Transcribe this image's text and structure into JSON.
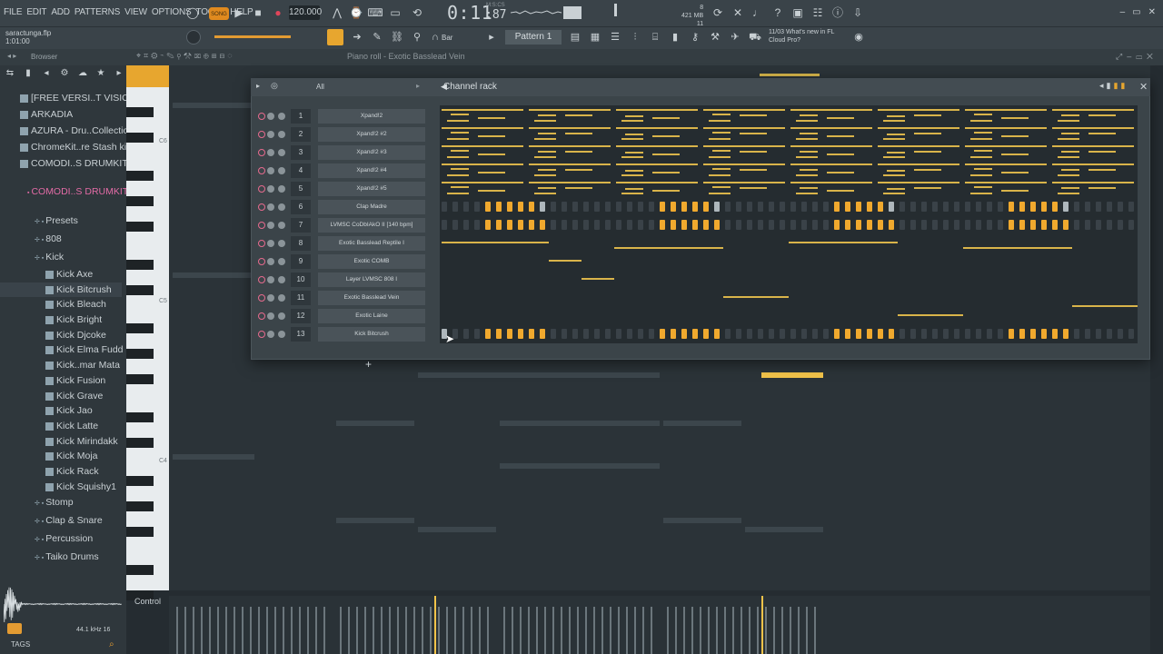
{
  "menu": [
    "FILE",
    "EDIT",
    "ADD",
    "PATTERNS",
    "VIEW",
    "OPTIONS",
    "TOOLS",
    "HELP"
  ],
  "transport": {
    "mode": "SONG",
    "tempo": "120.000",
    "time": "0:11",
    "time_frac": ":87",
    "time_unit": "M:S:CS"
  },
  "system": {
    "memory": "421 MB",
    "cpu": "11",
    "cpu_top": "8"
  },
  "project": {
    "filename": "saractunga.flp",
    "position": "1:01:00"
  },
  "toolbar2": {
    "snap": "Bar",
    "pattern": "Pattern 1"
  },
  "news": {
    "date": "11/03",
    "line1": "What's new in FL",
    "line2": "Cloud Pro?"
  },
  "panel_titles": {
    "browser": "Browser",
    "piano_roll": "Piano roll - Exotic Basslead Vein",
    "channel_rack": "Channel rack",
    "rack_filter": "All",
    "control": "Control"
  },
  "browser": {
    "items": [
      {
        "label": "[FREE VERSI..T VISION'",
        "type": "pack"
      },
      {
        "label": "ARKADIA",
        "type": "pack"
      },
      {
        "label": "AZURA - Dru..Collection",
        "type": "pack"
      },
      {
        "label": "ChromeKit..re Stash kit",
        "type": "pack"
      },
      {
        "label": "COMODI..S DRUMKIT",
        "type": "pack"
      },
      {
        "label": "COMODI..S DRUMKIT",
        "type": "folder"
      },
      {
        "label": "Presets",
        "type": "sub"
      },
      {
        "label": "808",
        "type": "sub"
      },
      {
        "label": "Kick",
        "type": "sub"
      },
      {
        "label": "Kick Axe",
        "type": "file"
      },
      {
        "label": "Kick Bitcrush",
        "type": "file"
      },
      {
        "label": "Kick Bleach",
        "type": "file"
      },
      {
        "label": "Kick Bright",
        "type": "file"
      },
      {
        "label": "Kick Djcoke",
        "type": "file"
      },
      {
        "label": "Kick Elma Fudd",
        "type": "file"
      },
      {
        "label": "Kick..mar Mata",
        "type": "file"
      },
      {
        "label": "Kick Fusion",
        "type": "file"
      },
      {
        "label": "Kick Grave",
        "type": "file"
      },
      {
        "label": "Kick Jao",
        "type": "file"
      },
      {
        "label": "Kick Latte",
        "type": "file"
      },
      {
        "label": "Kick Mirindakk",
        "type": "file"
      },
      {
        "label": "Kick Moja",
        "type": "file"
      },
      {
        "label": "Kick Rack",
        "type": "file"
      },
      {
        "label": "Kick Squishy1",
        "type": "file"
      },
      {
        "label": "Stomp",
        "type": "sub"
      },
      {
        "label": "Clap & Snare",
        "type": "sub"
      },
      {
        "label": "Percussion",
        "type": "sub"
      },
      {
        "label": "Taiko Drums",
        "type": "sub"
      }
    ],
    "sample_rate": "44.1 kHz 16",
    "tags_label": "TAGS"
  },
  "piano": {
    "octaves": [
      "C6",
      "C5",
      "C4"
    ]
  },
  "channels": [
    {
      "num": "1",
      "name": "Xpand!2",
      "kind": "notes"
    },
    {
      "num": "2",
      "name": "Xpand!2 #2",
      "kind": "notes"
    },
    {
      "num": "3",
      "name": "Xpand!2 #3",
      "kind": "notes"
    },
    {
      "num": "4",
      "name": "Xpand!2 #4",
      "kind": "notes"
    },
    {
      "num": "5",
      "name": "Xpand!2 #5",
      "kind": "notes"
    },
    {
      "num": "6",
      "name": "Clap Madre",
      "kind": "steps"
    },
    {
      "num": "7",
      "name": "LVMSC CoDbIAkO II [140 bpm]",
      "kind": "steps"
    },
    {
      "num": "8",
      "name": "Exotic Basslead Reptile I",
      "kind": "notes"
    },
    {
      "num": "9",
      "name": "Exotic COMB",
      "kind": "notes"
    },
    {
      "num": "10",
      "name": "Layer LVMSC 808 I",
      "kind": "notes"
    },
    {
      "num": "11",
      "name": "Exotic Basslead Vein",
      "kind": "notes"
    },
    {
      "num": "12",
      "name": "Exotic Laine",
      "kind": "notes"
    },
    {
      "num": "13",
      "name": "Kick Bitcrush",
      "kind": "steps"
    }
  ],
  "colors": {
    "accent": "#f0a92e",
    "note": "#d9b44a",
    "folder_pink": "#e36ba6",
    "bg": "#252c31"
  }
}
